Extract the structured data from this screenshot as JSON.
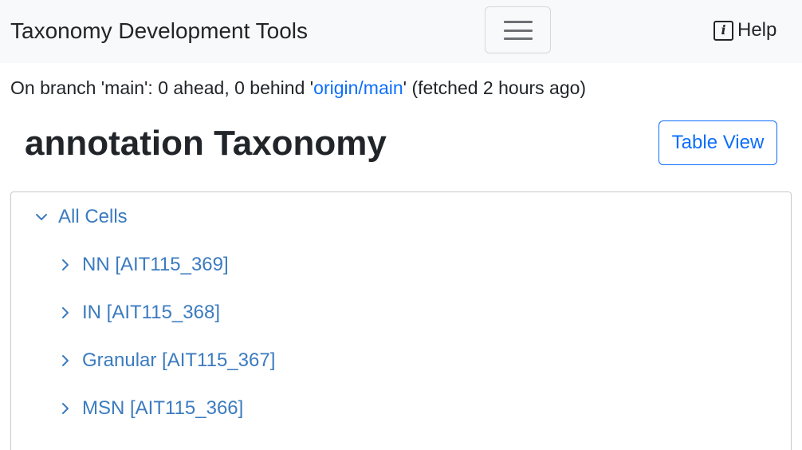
{
  "navbar": {
    "brand": "Taxonomy Development Tools",
    "help_label": "Help",
    "help_icon": "info-icon",
    "toggle_icon": "hamburger-menu-icon"
  },
  "branch_status": {
    "prefix": "On branch 'main': 0 ahead, 0 behind '",
    "remote_link": "origin/main",
    "suffix": "' (fetched 2 hours ago)"
  },
  "main": {
    "title": "annotation Taxonomy",
    "table_view_label": "Table View"
  },
  "tree": {
    "root": {
      "label": "All Cells",
      "expanded": true
    },
    "children": [
      {
        "label": "NN [AIT115_369]",
        "expanded": false
      },
      {
        "label": "IN [AIT115_368]",
        "expanded": false
      },
      {
        "label": "Granular [AIT115_367]",
        "expanded": false
      },
      {
        "label": "MSN [AIT115_366]",
        "expanded": false
      }
    ]
  },
  "colors": {
    "link": "#0d6efd",
    "tree_link": "#3b7bbf",
    "navbar_bg": "#f8f9fa"
  }
}
